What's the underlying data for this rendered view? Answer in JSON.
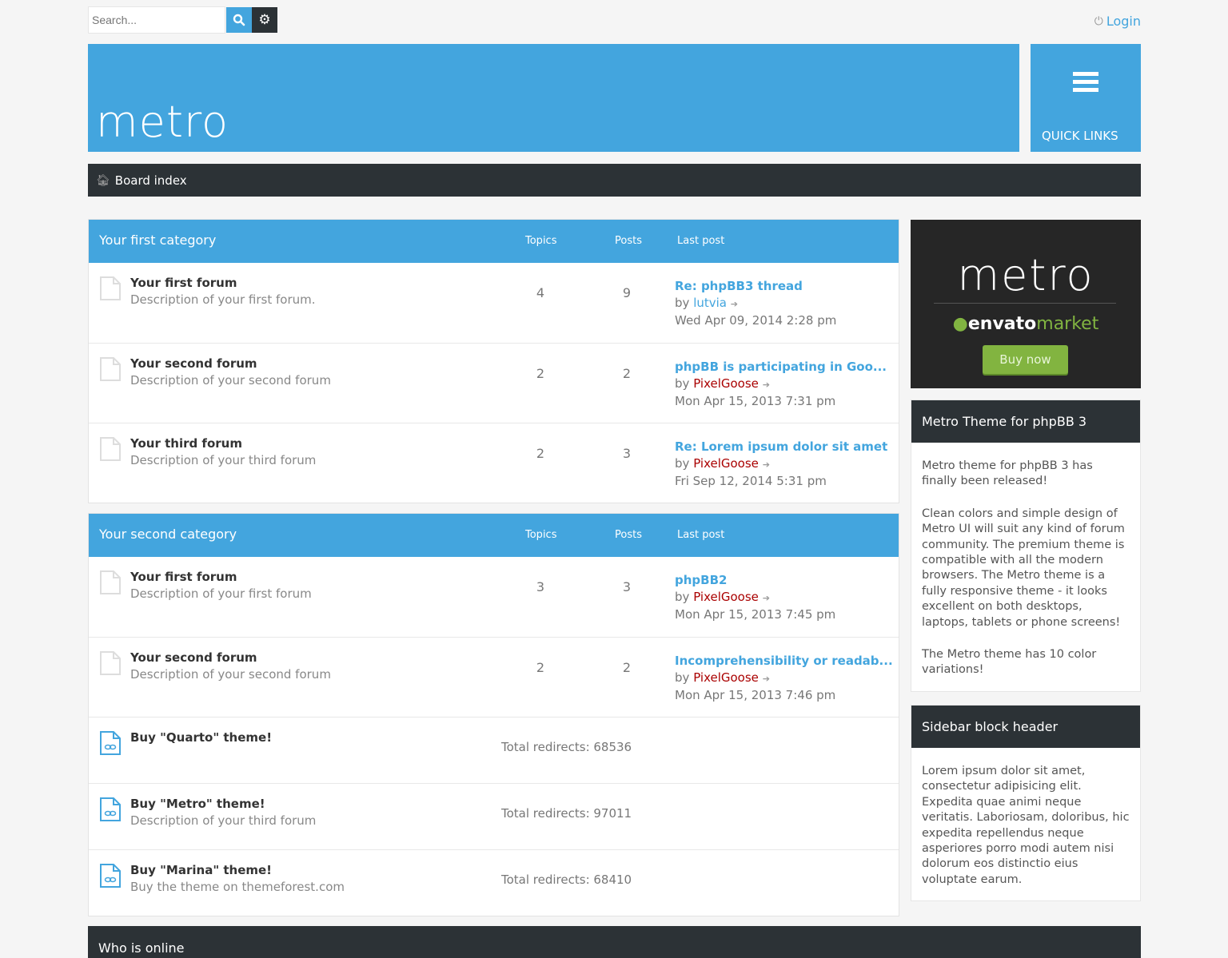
{
  "top": {
    "search_placeholder": "Search...",
    "search_icon": "search-icon",
    "advanced_icon": "gear-icon",
    "login_label": "Login"
  },
  "header": {
    "logo": "metro",
    "quick_links_label": "QUICK LINKS"
  },
  "breadcrumb": {
    "home_label": "Board index"
  },
  "columns": {
    "topics": "Topics",
    "posts": "Posts",
    "last_post": "Last post"
  },
  "categories": [
    {
      "title": "Your first category",
      "forums": [
        {
          "title": "Your first forum",
          "desc": "Description of your first forum.",
          "topics": "4",
          "posts": "9",
          "last_title": "Re: phpBB3 thread",
          "by": "by",
          "user": "lutvia",
          "date": "Wed Apr 09, 2014 2:28 pm"
        },
        {
          "title": "Your second forum",
          "desc": "Description of your second forum",
          "topics": "2",
          "posts": "2",
          "last_title": "phpBB is participating in Goo...",
          "by": "by",
          "user": "PixelGoose",
          "date": "Mon Apr 15, 2013 7:31 pm"
        },
        {
          "title": "Your third forum",
          "desc": "Description of your third forum",
          "topics": "2",
          "posts": "3",
          "last_title": "Re: Lorem ipsum dolor sit amet",
          "by": "by",
          "user": "PixelGoose",
          "date": "Fri Sep 12, 2014 5:31 pm"
        }
      ]
    },
    {
      "title": "Your second category",
      "forums": [
        {
          "title": "Your first forum",
          "desc": "Description of your first forum",
          "topics": "3",
          "posts": "3",
          "last_title": "phpBB2",
          "by": "by",
          "user": "PixelGoose",
          "date": "Mon Apr 15, 2013 7:45 pm"
        },
        {
          "title": "Your second forum",
          "desc": "Description of your second forum",
          "topics": "2",
          "posts": "2",
          "last_title": "Incomprehensibility or readab...",
          "by": "by",
          "user": "PixelGoose",
          "date": "Mon Apr 15, 2013 7:46 pm"
        }
      ],
      "links": [
        {
          "title": "Buy \"Quarto\" theme!",
          "desc": "",
          "redirects": "Total redirects: 68536"
        },
        {
          "title": "Buy \"Metro\" theme!",
          "desc": "Description of your third forum",
          "redirects": "Total redirects: 97011"
        },
        {
          "title": "Buy \"Marina\" theme!",
          "desc": "Buy the theme on themeforest.com",
          "redirects": "Total redirects: 68410"
        }
      ]
    }
  ],
  "sidebar": {
    "ad": {
      "title": "metro",
      "envato": "envato",
      "market": "market",
      "button": "Buy now"
    },
    "block1": {
      "header": "Metro Theme for phpBB 3",
      "paragraphs": [
        "Metro theme for phpBB 3 has finally been released!",
        "Clean colors and simple design of Metro UI will suit any kind of forum community. The premium theme is compatible with all the modern browsers. The Metro theme is a fully responsive theme - it looks excellent on both desktops, laptops, tablets or phone screens!",
        "The Metro theme has 10 color variations!"
      ]
    },
    "block2": {
      "header": "Sidebar block header",
      "paragraphs": [
        "Lorem ipsum dolor sit amet, consectetur adipisicing elit. Expedita quae animi neque veritatis. Laboriosam, doloribus, hic expedita repellendus neque asperiores porro modi autem nisi dolorum eos distinctio eius voluptate earum."
      ]
    }
  },
  "footer": {
    "who_is_online": "Who is online"
  },
  "colors": {
    "accent": "#43a5de",
    "dark": "#2c3236",
    "user_red": "#aa0000",
    "buy_green": "#82b440"
  }
}
